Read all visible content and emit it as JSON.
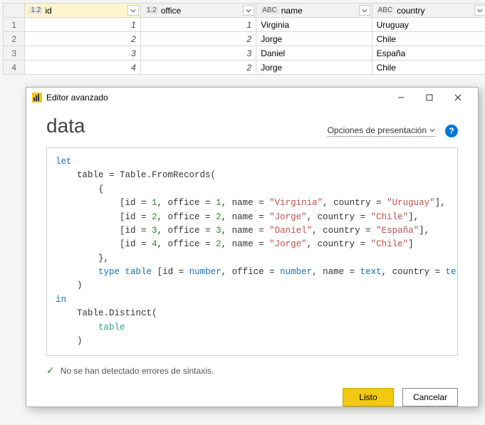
{
  "grid": {
    "columns": [
      {
        "type": "1.2",
        "label": "id"
      },
      {
        "type": "1.2",
        "label": "office"
      },
      {
        "type": "ABC",
        "label": "name"
      },
      {
        "type": "ABC",
        "label": "country"
      }
    ],
    "rows": [
      {
        "n": "1",
        "id": "1",
        "office": "1",
        "name": "Virginia",
        "country": "Uruguay"
      },
      {
        "n": "2",
        "id": "2",
        "office": "2",
        "name": "Jorge",
        "country": "Chile"
      },
      {
        "n": "3",
        "id": "3",
        "office": "3",
        "name": "Daniel",
        "country": "España"
      },
      {
        "n": "4",
        "id": "4",
        "office": "2",
        "name": "Jorge",
        "country": "Chile"
      }
    ]
  },
  "dialog": {
    "window_title": "Editor avanzado",
    "title": "data",
    "options_label": "Opciones de presentación",
    "status": "No se han detectado errores de sintaxis.",
    "done": "Listo",
    "cancel": "Cancelar"
  },
  "code": {
    "let": "let",
    "in": "in",
    "l1a": "    table = Table.FromRecords(",
    "l2": "        {",
    "r1a": "            [id = ",
    "r1b": ", office = ",
    "r1c": ", name = ",
    "r1d": ", country = ",
    "r1e": "],",
    "v1_id": "1",
    "v1_of": "1",
    "v1_nm": "\"Virginia\"",
    "v1_ct": "\"Uruguay\"",
    "v2_id": "2",
    "v2_of": "2",
    "v2_nm": "\"Jorge\"",
    "v2_ct": "\"Chile\"",
    "v3_id": "3",
    "v3_of": "3",
    "v3_nm": "\"Daniel\"",
    "v3_ct": "\"España\"",
    "v4_id": "4",
    "v4_of": "2",
    "v4_nm": "\"Jorge\"",
    "v4_ct": "\"Chile\"",
    "l7": "        },",
    "l8a": "        ",
    "l8_type": "type",
    "l8b": " ",
    "l8_table": "table",
    "l8c": " [id = ",
    "l8_num": "number",
    "l8d": ", office = ",
    "l8e": ", name = ",
    "l8_text": "text",
    "l8f": ", country = ",
    "l8g": "]",
    "l9": "    )",
    "l11": "    Table.Distinct(",
    "l12": "        ",
    "l12_tbl": "table",
    "l13": "    )"
  }
}
